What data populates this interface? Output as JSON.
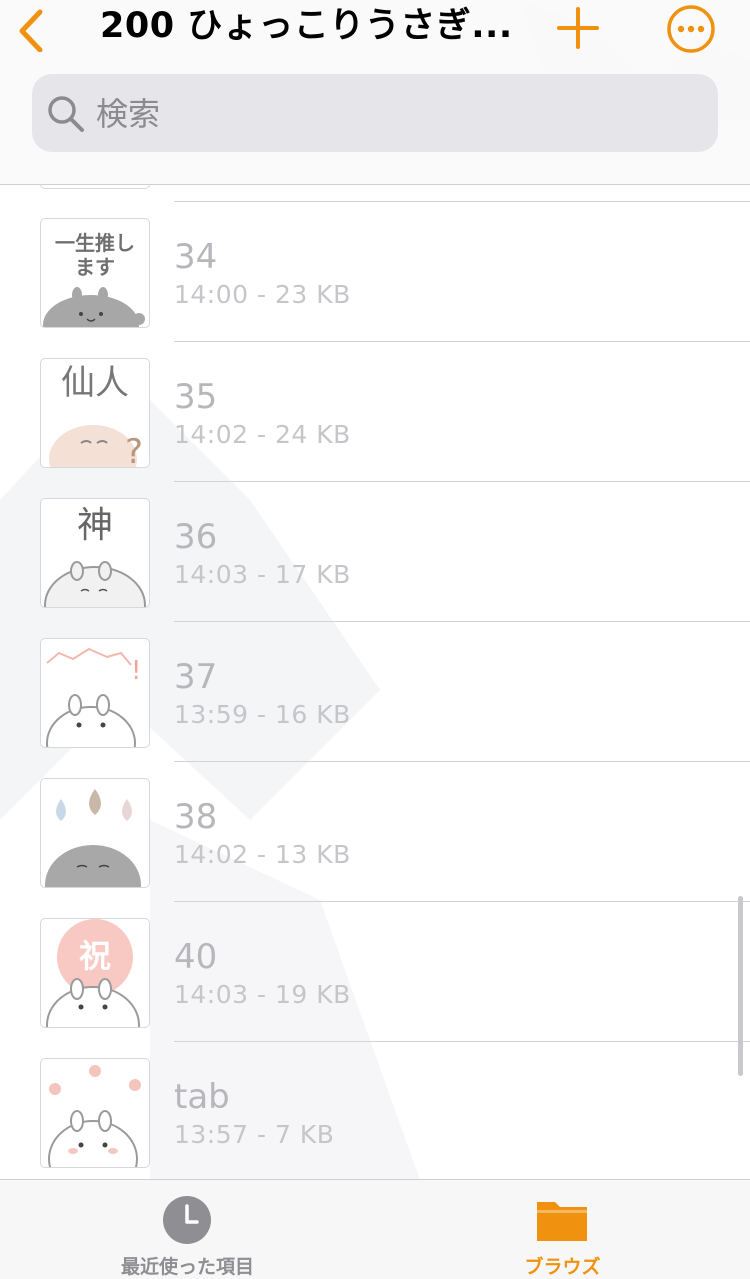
{
  "nav": {
    "title": "200 ひょっこりうさぎ...",
    "accent": "#f0920f"
  },
  "search": {
    "placeholder": "検索",
    "value": ""
  },
  "files": [
    {
      "name": "34",
      "meta": "14:00 - 23 KB",
      "thumb_text": "一生推します",
      "thumb_icon": "usagi-sticker-icon"
    },
    {
      "name": "35",
      "meta": "14:02 - 24 KB",
      "thumb_text": "仙人",
      "thumb_icon": "usagi-sticker-icon"
    },
    {
      "name": "36",
      "meta": "14:03 - 17 KB",
      "thumb_text": "神",
      "thumb_icon": "usagi-sticker-icon"
    },
    {
      "name": "37",
      "meta": "13:59 - 16 KB",
      "thumb_text": "",
      "thumb_icon": "usagi-sticker-icon"
    },
    {
      "name": "38",
      "meta": "14:02 - 13 KB",
      "thumb_text": "",
      "thumb_icon": "usagi-sticker-icon"
    },
    {
      "name": "40",
      "meta": "14:03 - 19 KB",
      "thumb_text": "祝",
      "thumb_icon": "usagi-sticker-icon"
    },
    {
      "name": "tab",
      "meta": "13:57 - 7 KB",
      "thumb_text": "",
      "thumb_icon": "usagi-sticker-icon"
    }
  ],
  "tabbar": {
    "recents_label": "最近使った項目",
    "browse_label": "ブラウズ",
    "active": "browse",
    "inactive_color": "#8e8e93",
    "active_color": "#f0920f"
  }
}
